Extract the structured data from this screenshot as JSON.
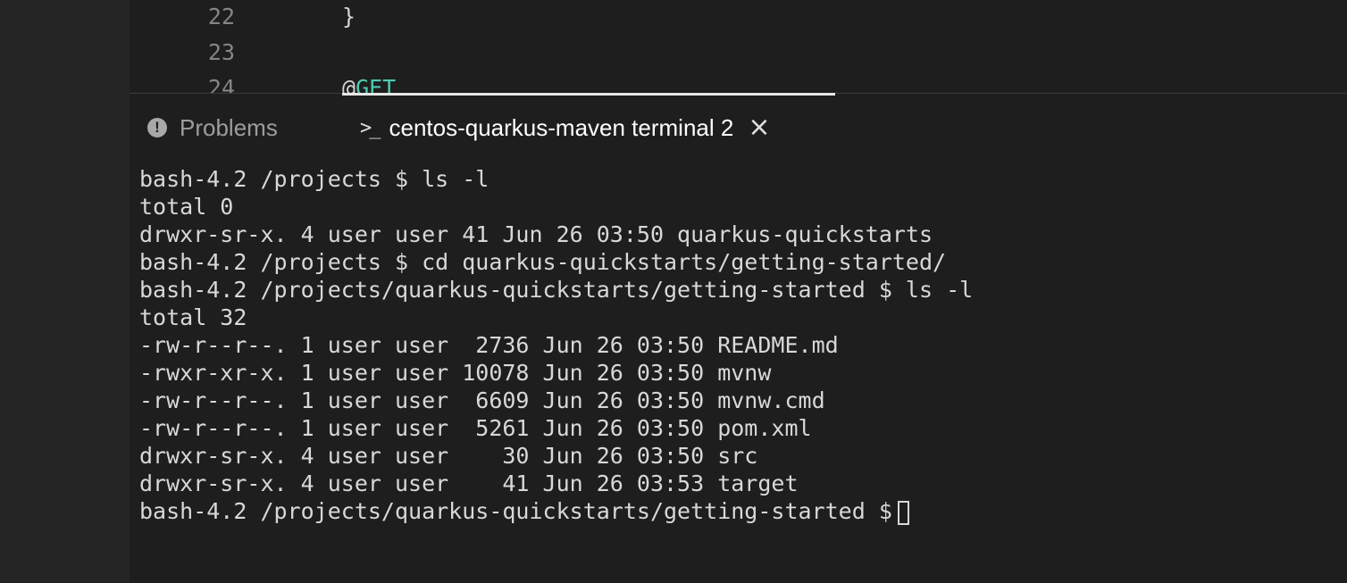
{
  "editor": {
    "lines": [
      {
        "num": "22",
        "code": "}"
      },
      {
        "num": "23",
        "code": ""
      },
      {
        "num": "24",
        "anno_at": "@",
        "anno_name": "GET"
      }
    ]
  },
  "panel": {
    "tabs": [
      {
        "label": "Problems",
        "icon": "warning-circle-icon"
      },
      {
        "label": "centos-quarkus-maven terminal 2",
        "icon": "terminal-prompt-icon",
        "close_icon": "close-icon"
      }
    ],
    "close_glyph": "×",
    "problems_glyph": "!",
    "terminal_glyph": ">_"
  },
  "terminal": {
    "lines": [
      "bash-4.2 /projects $ ls -l",
      "total 0",
      "drwxr-sr-x. 4 user user 41 Jun 26 03:50 quarkus-quickstarts",
      "bash-4.2 /projects $ cd quarkus-quickstarts/getting-started/",
      "bash-4.2 /projects/quarkus-quickstarts/getting-started $ ls -l",
      "total 32",
      "-rw-r--r--. 1 user user  2736 Jun 26 03:50 README.md",
      "-rwxr-xr-x. 1 user user 10078 Jun 26 03:50 mvnw",
      "-rw-r--r--. 1 user user  6609 Jun 26 03:50 mvnw.cmd",
      "-rw-r--r--. 1 user user  5261 Jun 26 03:50 pom.xml",
      "drwxr-sr-x. 4 user user    30 Jun 26 03:50 src",
      "drwxr-sr-x. 4 user user    41 Jun 26 03:53 target"
    ],
    "prompt": "bash-4.2 /projects/quarkus-quickstarts/getting-started $"
  }
}
